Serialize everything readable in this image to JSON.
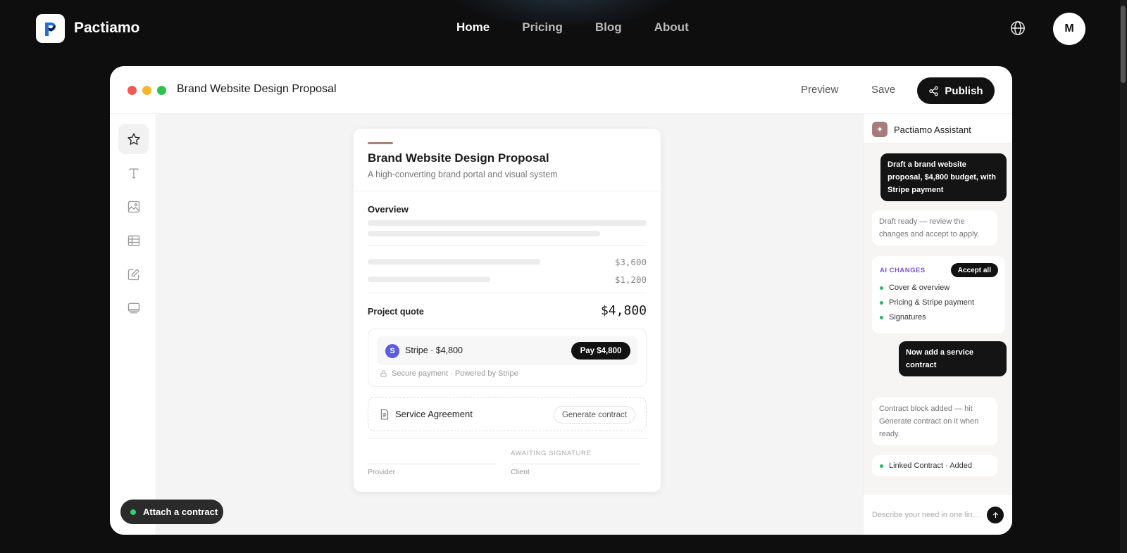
{
  "nav": {
    "brand": "Pactiamo",
    "links": [
      "Home",
      "Pricing",
      "Blog",
      "About"
    ],
    "active": "Home",
    "avatar_initial": "M"
  },
  "window": {
    "title": "Brand Website Design Proposal",
    "preview_label": "Preview",
    "save_label": "Save",
    "publish_label": "Publish"
  },
  "tools": [
    "star-icon",
    "text-icon",
    "image-icon",
    "table-icon",
    "edit-icon",
    "device-icon"
  ],
  "attach_label": "Attach a contract",
  "document": {
    "title": "Brand Website Design Proposal",
    "subtitle": "A high-converting brand portal and visual system",
    "overview_label": "Overview",
    "line_items": [
      "$3,600",
      "$1,200"
    ],
    "quote_label": "Project quote",
    "quote_value": "$4,800",
    "payment": {
      "provider_badge": "S",
      "provider_text": "Stripe · $4,800",
      "pay_button": "Pay $4,800",
      "secure_text": "Secure payment · Powered by Stripe"
    },
    "agreement": {
      "label": "Service Agreement",
      "button": "Generate contract"
    },
    "signatures": {
      "status": "AWAITING SIGNATURE",
      "provider": "Provider",
      "client": "Client"
    }
  },
  "assistant": {
    "title": "Pactiamo Assistant",
    "messages": {
      "user_1": "Draft a brand website proposal, $4,800 budget, with Stripe payment",
      "bot_1": "Draft ready — review the changes and accept to apply.",
      "user_2": "Now add a service contract",
      "bot_2": "Contract block added — hit Generate contract on it when ready."
    },
    "changes": {
      "title": "AI CHANGES",
      "accept_label": "Accept all",
      "items": [
        "Cover & overview",
        "Pricing & Stripe payment",
        "Signatures"
      ]
    },
    "linked": "Linked Contract · Added",
    "input_placeholder": "Describe your need in one lin..."
  },
  "colors": {
    "page_bg": "#0e0e0f",
    "accent_purple": "#7b54d8",
    "stripe": "#5c5ce0",
    "status_green": "#2fd36b",
    "doc_accent": "#b08076"
  }
}
